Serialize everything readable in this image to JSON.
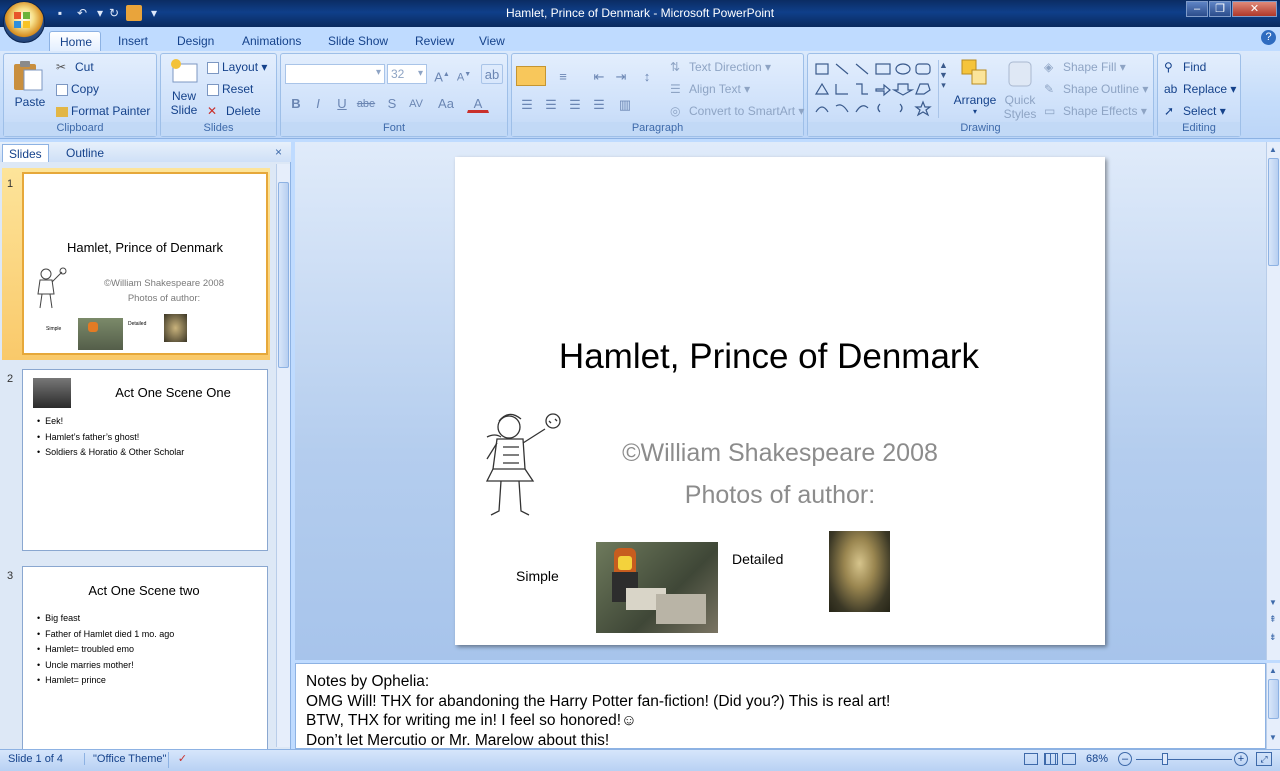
{
  "window": {
    "title": "Hamlet, Prince of Denmark - Microsoft PowerPoint",
    "controls": [
      "minimize",
      "restore",
      "close"
    ]
  },
  "ribbon_tabs": [
    "Home",
    "Insert",
    "Design",
    "Animations",
    "Slide Show",
    "Review",
    "View"
  ],
  "active_tab": "Home",
  "clipboard": {
    "paste": "Paste",
    "cut": "Cut",
    "copy": "Copy",
    "format_painter": "Format Painter",
    "label": "Clipboard"
  },
  "slides_group": {
    "new_slide_1": "New",
    "new_slide_2": "Slide",
    "layout": "Layout",
    "reset": "Reset",
    "delete": "Delete",
    "label": "Slides"
  },
  "font_group": {
    "font_name": "",
    "font_size": "32",
    "label": "Font"
  },
  "paragraph_group": {
    "text_direction": "Text Direction",
    "align_text": "Align Text",
    "smartart": "Convert to SmartArt",
    "label": "Paragraph"
  },
  "drawing_group": {
    "arrange": "Arrange",
    "quick_styles_1": "Quick",
    "quick_styles_2": "Styles",
    "shape_fill": "Shape Fill",
    "shape_outline": "Shape Outline",
    "shape_effects": "Shape Effects",
    "label": "Drawing"
  },
  "editing_group": {
    "find": "Find",
    "replace": "Replace",
    "select": "Select",
    "label": "Editing"
  },
  "panel_tabs": {
    "slides": "Slides",
    "outline": "Outline"
  },
  "thumbnails": [
    {
      "num": "1",
      "title": "Hamlet, Prince of Denmark",
      "copyright": "©William Shakespeare 2008",
      "photos": "Photos of author:",
      "simple": "Simple",
      "detailed": "Detailed"
    },
    {
      "num": "2",
      "title": "Act One Scene One",
      "bullets": [
        "Eek!",
        "Hamlet’s father’s ghost!",
        "Soldiers & Horatio & Other Scholar"
      ]
    },
    {
      "num": "3",
      "title": "Act One Scene two",
      "bullets": [
        "Big feast",
        "Father of Hamlet died 1 mo. ago",
        "Hamlet=  troubled emo",
        "Uncle marries mother!",
        "Hamlet= prince"
      ]
    }
  ],
  "slide": {
    "title": "Hamlet, Prince of Denmark",
    "copyright": "©William Shakespeare 2008",
    "photos_label": "Photos of author:",
    "simple_label": "Simple",
    "detailed_label": "Detailed"
  },
  "notes": {
    "line1": "Notes by Ophelia:",
    "line2": "OMG Will! THX for abandoning the Harry Potter fan-fiction! (Did you?) This is real art!",
    "line3": "BTW, THX for writing me in! I feel so honored!☺",
    "line4": "Don’t let Mercutio or Mr. Marelow about this!"
  },
  "status": {
    "slide_count": "Slide 1 of 4",
    "theme": "\"Office Theme\"",
    "zoom": "68%"
  },
  "colors": {
    "ribbon_bg": "#c4dcfa",
    "title_bar": "#0f3f8a",
    "selection": "#f9c96a",
    "text_blue": "#15428b"
  }
}
